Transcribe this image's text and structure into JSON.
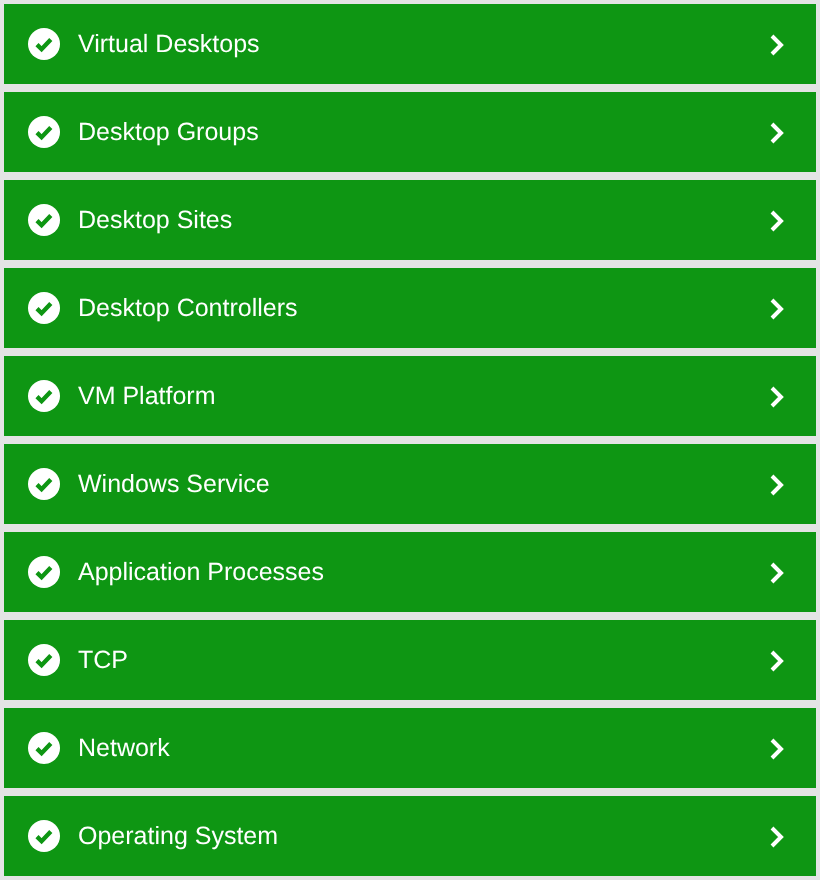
{
  "items": [
    {
      "label": "Virtual Desktops"
    },
    {
      "label": "Desktop Groups"
    },
    {
      "label": "Desktop Sites"
    },
    {
      "label": "Desktop Controllers"
    },
    {
      "label": "VM Platform"
    },
    {
      "label": "Windows Service"
    },
    {
      "label": "Application Processes"
    },
    {
      "label": "TCP"
    },
    {
      "label": "Network"
    },
    {
      "label": "Operating System"
    }
  ]
}
